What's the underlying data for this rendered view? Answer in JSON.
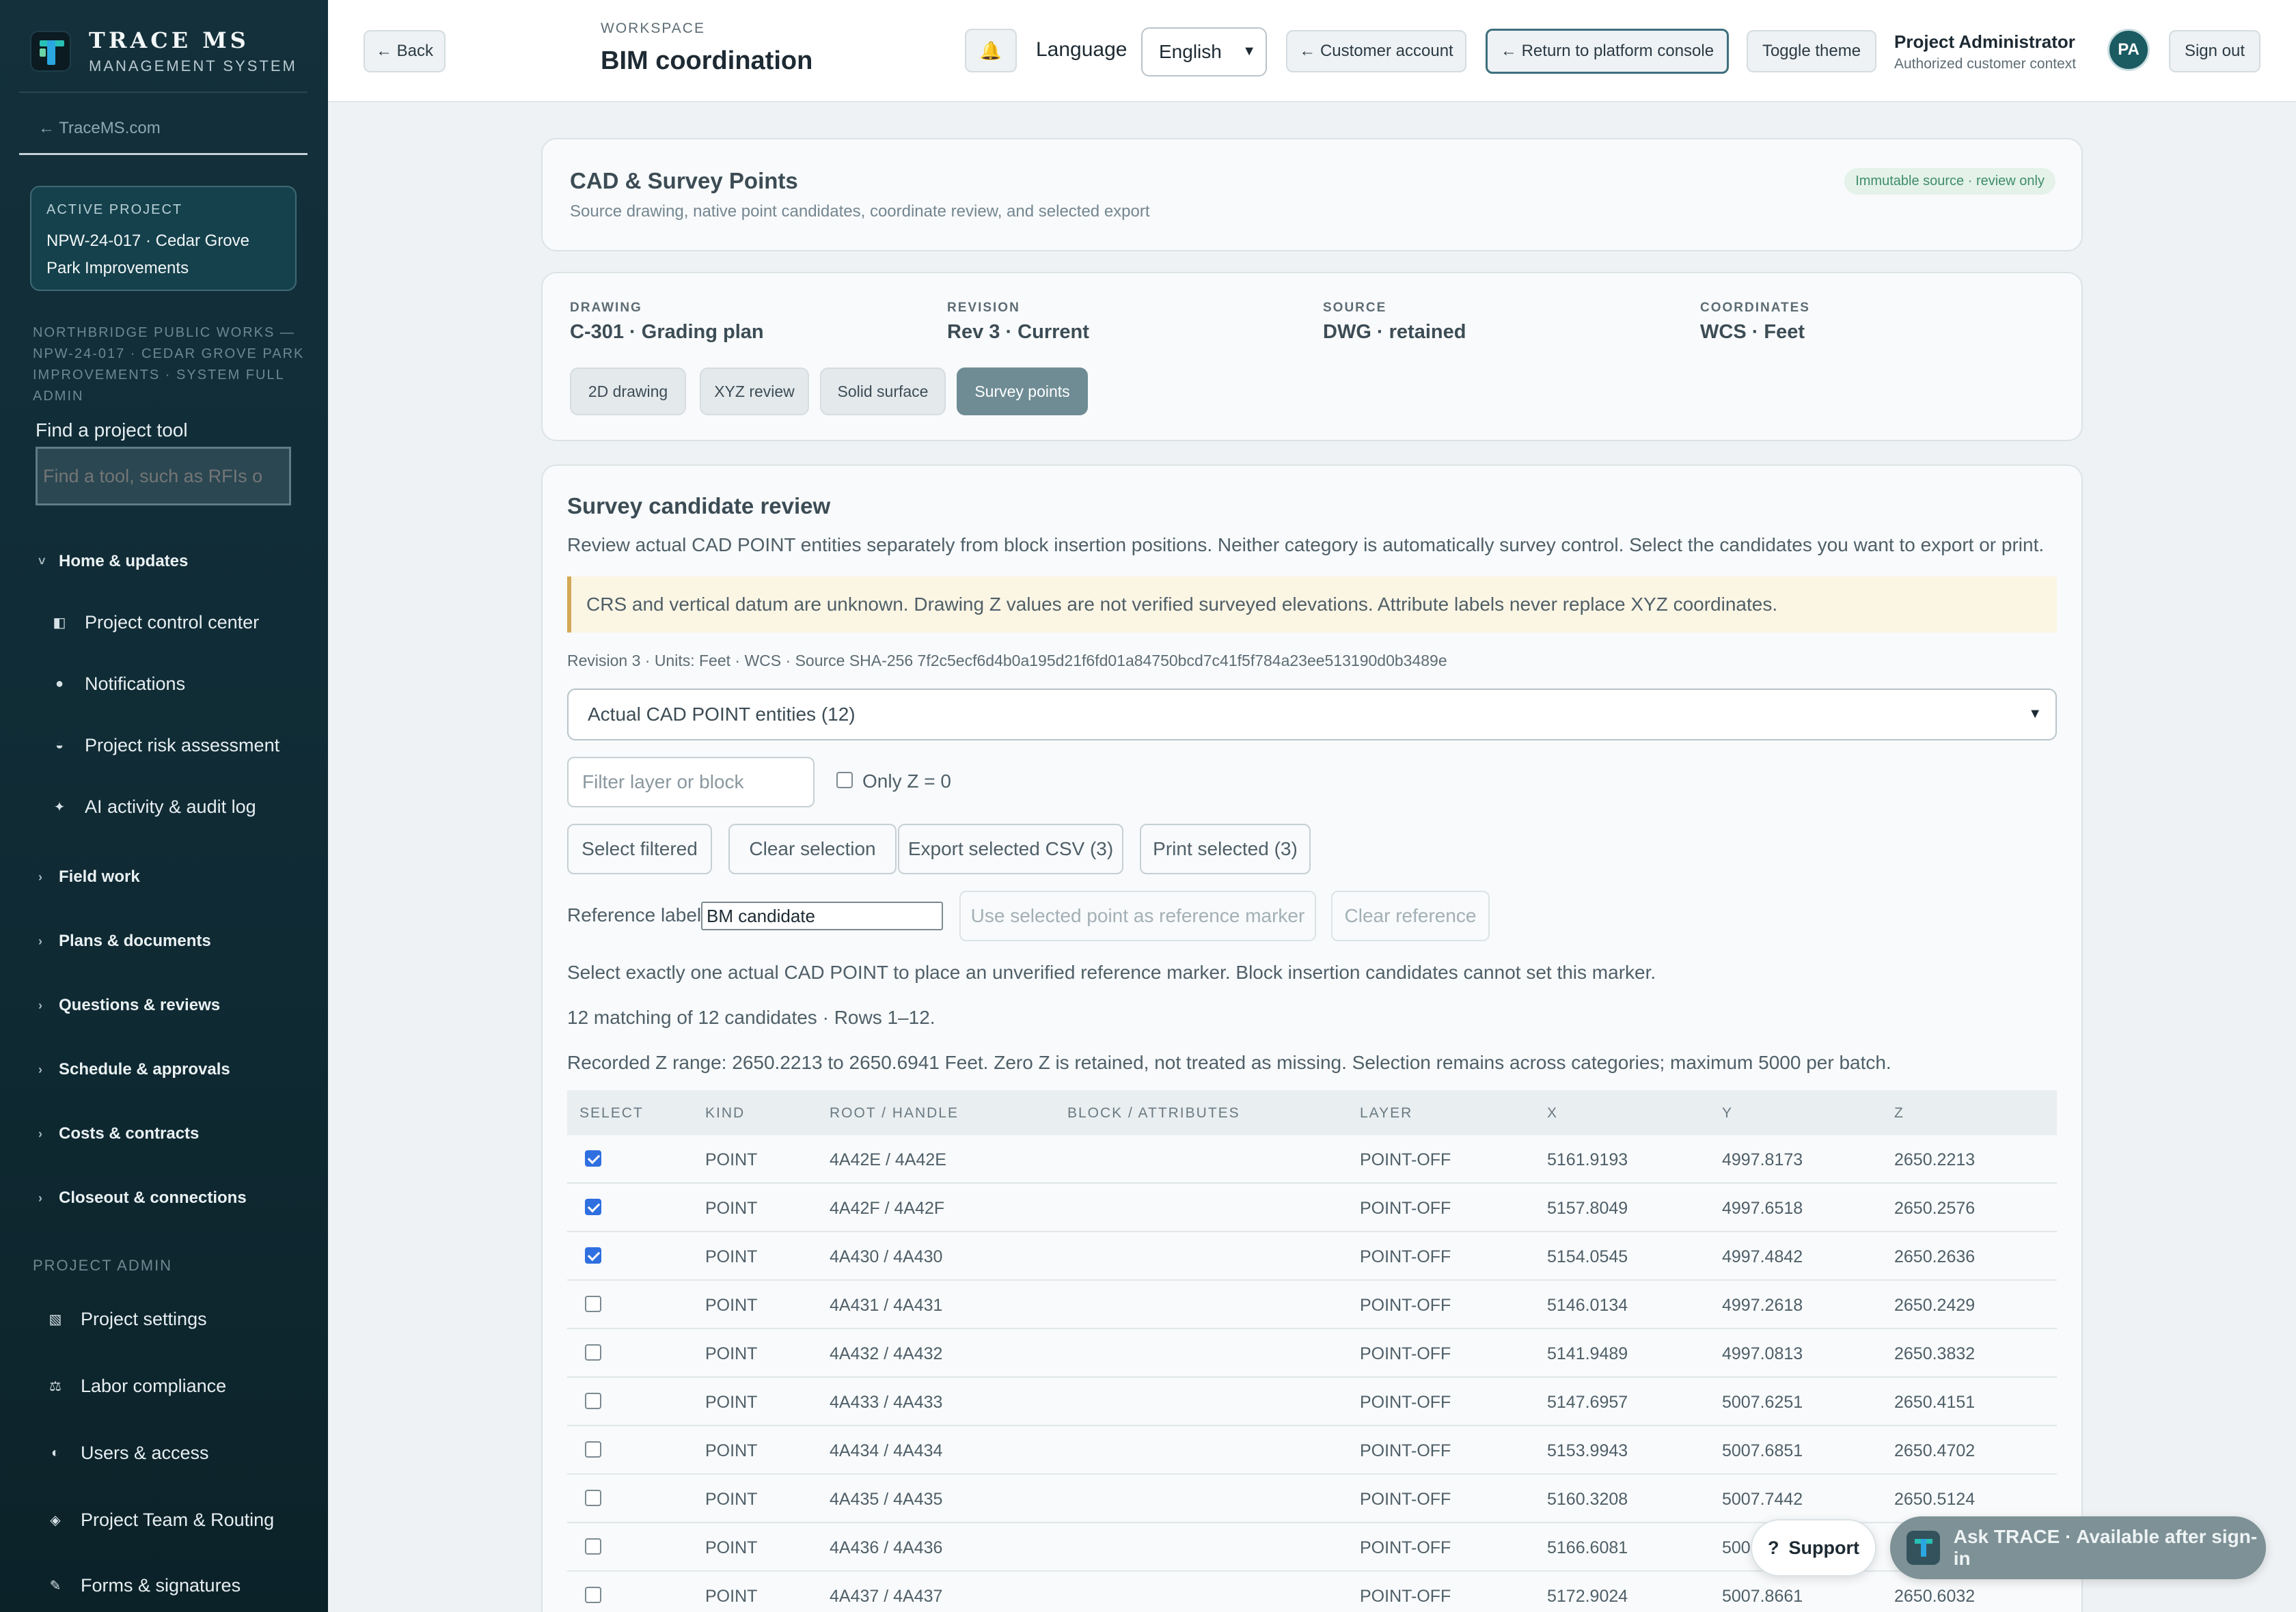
{
  "sidebar": {
    "brand_name": "TRACE MS",
    "brand_sub": "MANAGEMENT SYSTEM",
    "back_link": "← TraceMS.com",
    "active_project_label": "ACTIVE PROJECT",
    "active_project_value": "NPW-24-017 · Cedar Grove Park Improvements",
    "org_line": "NORTHBRIDGE PUBLIC WORKS — NPW-24-017 · CEDAR GROVE PARK IMPROVEMENTS · SYSTEM FULL ADMIN",
    "find_label": "Find a project tool",
    "find_placeholder": "Find a tool, such as RFIs o",
    "groups": [
      {
        "label": "Home & updates",
        "expanded": true
      },
      {
        "label": "Field work",
        "expanded": false
      },
      {
        "label": "Plans & documents",
        "expanded": false
      },
      {
        "label": "Questions & reviews",
        "expanded": false
      },
      {
        "label": "Schedule & approvals",
        "expanded": false
      },
      {
        "label": "Costs & contracts",
        "expanded": false
      },
      {
        "label": "Closeout & connections",
        "expanded": false
      }
    ],
    "home_items": [
      {
        "label": "Project control center",
        "icon": "panel-icon"
      },
      {
        "label": "Notifications",
        "icon": "dot-icon"
      },
      {
        "label": "Project risk assessment",
        "icon": "half-circle-icon"
      },
      {
        "label": "AI activity & audit log",
        "icon": "sparkle-icon"
      }
    ],
    "admin_section": "PROJECT ADMIN",
    "admin_items": [
      {
        "label": "Project settings",
        "icon": "settings-icon"
      },
      {
        "label": "Labor compliance",
        "icon": "scale-icon"
      },
      {
        "label": "Users & access",
        "icon": "users-icon"
      },
      {
        "label": "Project Team & Routing",
        "icon": "diamond-icon"
      },
      {
        "label": "Forms & signatures",
        "icon": "pen-icon"
      }
    ]
  },
  "topbar": {
    "back_label": "← Back",
    "workspace_label": "WORKSPACE",
    "workspace_title": "BIM coordination",
    "bell_icon": "bell-icon",
    "language_label": "Language",
    "language_value": "English",
    "customer_account_label": "← Customer account",
    "return_console_label": "← Return to platform console",
    "toggle_theme_label": "Toggle theme",
    "user_name": "Project Administrator",
    "user_sub": "Authorized customer context",
    "avatar_initials": "PA",
    "sign_out_label": "Sign out"
  },
  "header_card": {
    "title": "CAD & Survey Points",
    "subtitle": "Source drawing, native point candidates, coordinate review, and selected export",
    "badge": "Immutable source · review only"
  },
  "drawing_card": {
    "fields": [
      {
        "label": "DRAWING",
        "value": "C-301 · Grading plan"
      },
      {
        "label": "REVISION",
        "value": "Rev 3 · Current"
      },
      {
        "label": "SOURCE",
        "value": "DWG · retained"
      },
      {
        "label": "COORDINATES",
        "value": "WCS · Feet"
      }
    ],
    "tabs": [
      {
        "label": "2D drawing",
        "active": false
      },
      {
        "label": "XYZ review",
        "active": false
      },
      {
        "label": "Solid surface",
        "active": false
      },
      {
        "label": "Survey points",
        "active": true
      }
    ]
  },
  "review": {
    "title": "Survey candidate review",
    "description": "Review actual CAD POINT entities separately from block insertion positions. Neither category is automatically survey control. Select the candidates you want to export or print.",
    "warning": "CRS and vertical datum are unknown. Drawing Z values are not verified surveyed elevations. Attribute labels never replace XYZ coordinates.",
    "meta_line": "Revision 3 · Units: Feet · WCS · Source SHA-256 7f2c5ecf6d4b0a195d21f6fd01a84750bcd7c41f5f784a23ee513190d0b3489e",
    "category_select": "Actual CAD POINT entities (12)",
    "filter_placeholder": "Filter layer or block",
    "only_z_label": "Only Z = 0",
    "select_filtered": "Select filtered",
    "clear_selection": "Clear selection",
    "export_csv": "Export selected CSV (3)",
    "print_selected": "Print selected (3)",
    "reference_label": "Reference label",
    "reference_value": "BM candidate",
    "use_reference": "Use selected point as reference marker",
    "clear_reference": "Clear reference",
    "info_1": "Select exactly one actual CAD POINT to place an unverified reference marker. Block insertion candidates cannot set this marker.",
    "info_2": "12 matching of 12 candidates · Rows 1–12.",
    "info_3": "Recorded Z range: 2650.2213 to 2650.6941 Feet. Zero Z is retained, not treated as missing. Selection remains across categories; maximum 5000 per batch."
  },
  "table": {
    "headers": [
      "SELECT",
      "KIND",
      "ROOT / HANDLE",
      "BLOCK / ATTRIBUTES",
      "LAYER",
      "X",
      "Y",
      "Z"
    ],
    "rows": [
      {
        "selected": true,
        "kind": "POINT",
        "handle": "4A42E / 4A42E",
        "block": "",
        "layer": "POINT-OFF",
        "x": "5161.9193",
        "y": "4997.8173",
        "z": "2650.2213"
      },
      {
        "selected": true,
        "kind": "POINT",
        "handle": "4A42F / 4A42F",
        "block": "",
        "layer": "POINT-OFF",
        "x": "5157.8049",
        "y": "4997.6518",
        "z": "2650.2576"
      },
      {
        "selected": true,
        "kind": "POINT",
        "handle": "4A430 / 4A430",
        "block": "",
        "layer": "POINT-OFF",
        "x": "5154.0545",
        "y": "4997.4842",
        "z": "2650.2636"
      },
      {
        "selected": false,
        "kind": "POINT",
        "handle": "4A431 / 4A431",
        "block": "",
        "layer": "POINT-OFF",
        "x": "5146.0134",
        "y": "4997.2618",
        "z": "2650.2429"
      },
      {
        "selected": false,
        "kind": "POINT",
        "handle": "4A432 / 4A432",
        "block": "",
        "layer": "POINT-OFF",
        "x": "5141.9489",
        "y": "4997.0813",
        "z": "2650.3832"
      },
      {
        "selected": false,
        "kind": "POINT",
        "handle": "4A433 / 4A433",
        "block": "",
        "layer": "POINT-OFF",
        "x": "5147.6957",
        "y": "5007.6251",
        "z": "2650.4151"
      },
      {
        "selected": false,
        "kind": "POINT",
        "handle": "4A434 / 4A434",
        "block": "",
        "layer": "POINT-OFF",
        "x": "5153.9943",
        "y": "5007.6851",
        "z": "2650.4702"
      },
      {
        "selected": false,
        "kind": "POINT",
        "handle": "4A435 / 4A435",
        "block": "",
        "layer": "POINT-OFF",
        "x": "5160.3208",
        "y": "5007.7442",
        "z": "2650.5124"
      },
      {
        "selected": false,
        "kind": "POINT",
        "handle": "4A436 / 4A436",
        "block": "",
        "layer": "POINT-OFF",
        "x": "5166.6081",
        "y": "500",
        "z": ""
      },
      {
        "selected": false,
        "kind": "POINT",
        "handle": "4A437 / 4A437",
        "block": "",
        "layer": "POINT-OFF",
        "x": "5172.9024",
        "y": "5007.8661",
        "z": "2650.6032"
      }
    ]
  },
  "floating": {
    "support_label": "Support",
    "support_icon": "?",
    "ask_label": "Ask TRACE · Available after sign-in"
  }
}
